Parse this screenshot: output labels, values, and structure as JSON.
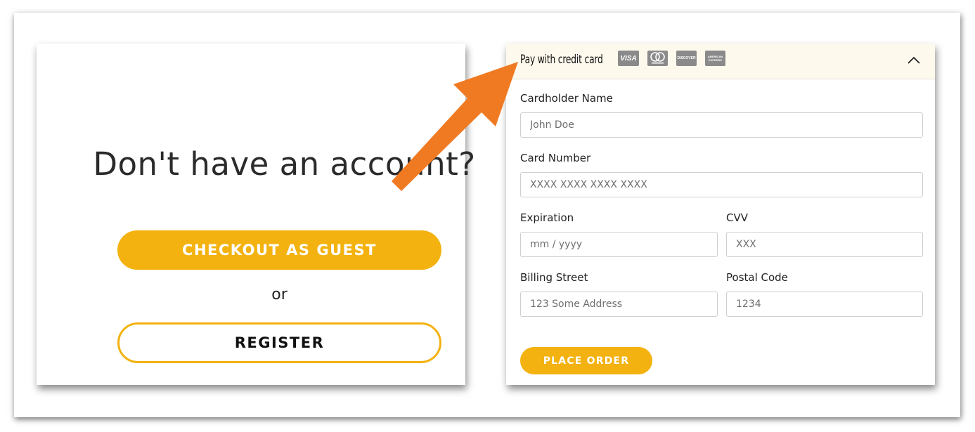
{
  "left": {
    "title": "Don't have an account?",
    "guest_label": "CHECKOUT AS GUEST",
    "or_label": "or",
    "register_label": "REGISTER"
  },
  "payment": {
    "header_title": "Pay with credit card",
    "card_logos": [
      "VISA",
      "mastercard",
      "DISCOVER",
      "AMERICAN EXPRESS"
    ],
    "fields": {
      "cardholder_label": "Cardholder Name",
      "cardholder_placeholder": "John Doe",
      "number_label": "Card Number",
      "number_placeholder": "XXXX XXXX XXXX XXXX",
      "expiration_label": "Expiration",
      "expiration_placeholder": "mm / yyyy",
      "cvv_label": "CVV",
      "cvv_placeholder": "XXX",
      "street_label": "Billing Street",
      "street_placeholder": "123 Some Address",
      "postal_label": "Postal Code",
      "postal_placeholder": "1234"
    },
    "place_order_label": "PLACE ORDER"
  },
  "colors": {
    "accent": "#f3b20f",
    "arrow": "#f07a22",
    "header_bg": "#fdf9ed"
  },
  "icons": {
    "header_toggle": "chevron-up-icon",
    "pointer": "arrow-icon"
  }
}
